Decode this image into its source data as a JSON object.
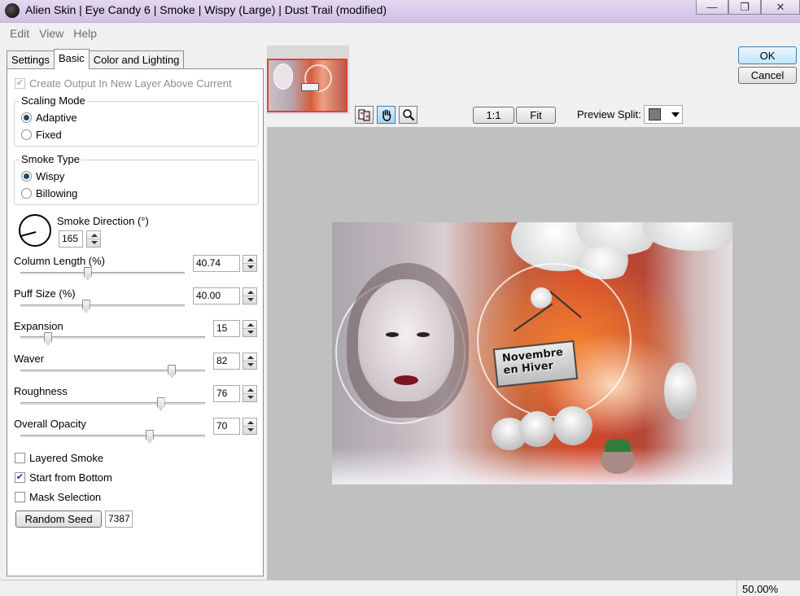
{
  "window": {
    "title": "Alien Skin | Eye Candy 6 | Smoke | Wispy (Large) | Dust Trail (modified)",
    "controls": [
      "—",
      "❐",
      "✕"
    ]
  },
  "menu": [
    "Edit",
    "View",
    "Help"
  ],
  "tabs": [
    "Settings",
    "Basic",
    "Color and Lighting"
  ],
  "basic": {
    "create_output_label": "Create Output In New Layer Above Current",
    "scaling_mode": {
      "label": "Scaling Mode",
      "options": [
        "Adaptive",
        "Fixed"
      ],
      "selected": "Adaptive"
    },
    "smoke_type": {
      "label": "Smoke Type",
      "options": [
        "Wispy",
        "Billowing"
      ],
      "selected": "Wispy"
    },
    "smoke_direction": {
      "label": "Smoke Direction (°)",
      "value": "165"
    },
    "column_length": {
      "label": "Column Length (%)",
      "value": "40.74",
      "level": 0.41
    },
    "puff_size": {
      "label": "Puff Size (%)",
      "value": "40.00",
      "level": 0.4
    },
    "expansion": {
      "label": "Expansion",
      "value": "15",
      "level": 0.15
    },
    "waver": {
      "label": "Waver",
      "value": "82",
      "level": 0.82
    },
    "roughness": {
      "label": "Roughness",
      "value": "76",
      "level": 0.76
    },
    "overall_opacity": {
      "label": "Overall Opacity",
      "value": "70",
      "level": 0.7
    },
    "layered_smoke": {
      "label": "Layered Smoke",
      "checked": false
    },
    "start_from_bottom": {
      "label": "Start from Bottom",
      "checked": true
    },
    "mask_selection": {
      "label": "Mask Selection",
      "checked": false
    },
    "random_seed": {
      "label": "Random Seed",
      "value": "7387"
    }
  },
  "dialog": {
    "ok": "OK",
    "cancel": "Cancel"
  },
  "toolbar": {
    "zoom_1to1": "1:1",
    "fit": "Fit",
    "preview_split_label": "Preview Split:",
    "tool_icons": [
      "compare-icon",
      "hand-icon",
      "magnifier-icon"
    ]
  },
  "preview": {
    "sign_text": "Novembre en Hiver"
  },
  "status": {
    "zoom": "50.00%"
  },
  "colors": {
    "accent": "#3c7fb1",
    "preview_bg": "#c0c0c0",
    "thumb_border": "#e0413a"
  }
}
